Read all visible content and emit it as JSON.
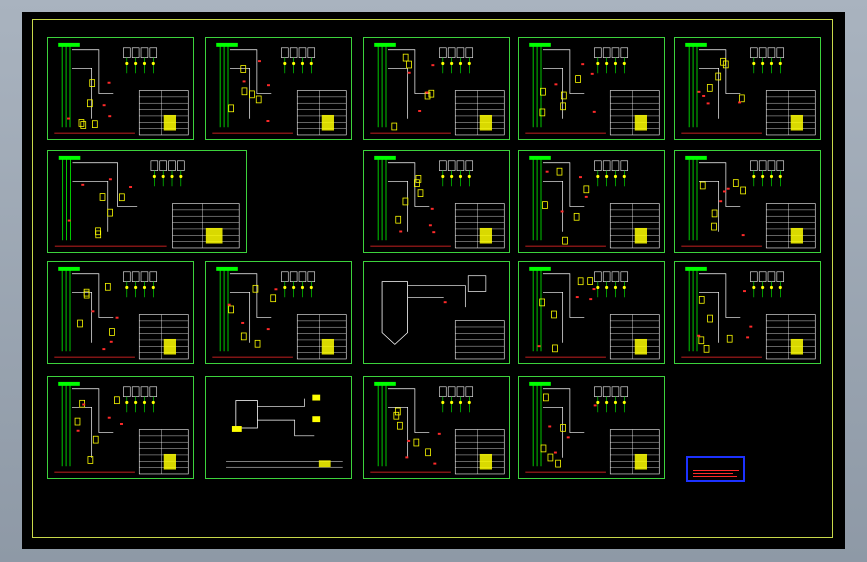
{
  "colors": {
    "background": "#000000",
    "sheet_border": "#3cd23c",
    "outer_frame": "#c8d84a",
    "wire_white": "#ffffff",
    "component_yellow": "#ffff00",
    "bus_green": "#00ff00",
    "relay_red": "#ff2a2a",
    "legend_border": "#1c32ff"
  },
  "drawing": {
    "sheet_count": 19,
    "sheets": [
      {
        "kind": "schematic"
      },
      {
        "kind": "schematic"
      },
      {
        "kind": "schematic"
      },
      {
        "kind": "schematic"
      },
      {
        "kind": "schematic"
      },
      {
        "kind": "schematic"
      },
      {
        "kind": "schematic"
      },
      {
        "kind": "schematic"
      },
      {
        "kind": "schematic"
      },
      {
        "kind": "schematic"
      },
      {
        "kind": "schematic"
      },
      {
        "kind": "box"
      },
      {
        "kind": "schematic"
      },
      {
        "kind": "schematic"
      },
      {
        "kind": "schematic"
      },
      {
        "kind": "wiring"
      },
      {
        "kind": "schematic"
      },
      {
        "kind": "schematic"
      }
    ]
  },
  "legend": {
    "title": "",
    "icon": "title-block-legend"
  }
}
